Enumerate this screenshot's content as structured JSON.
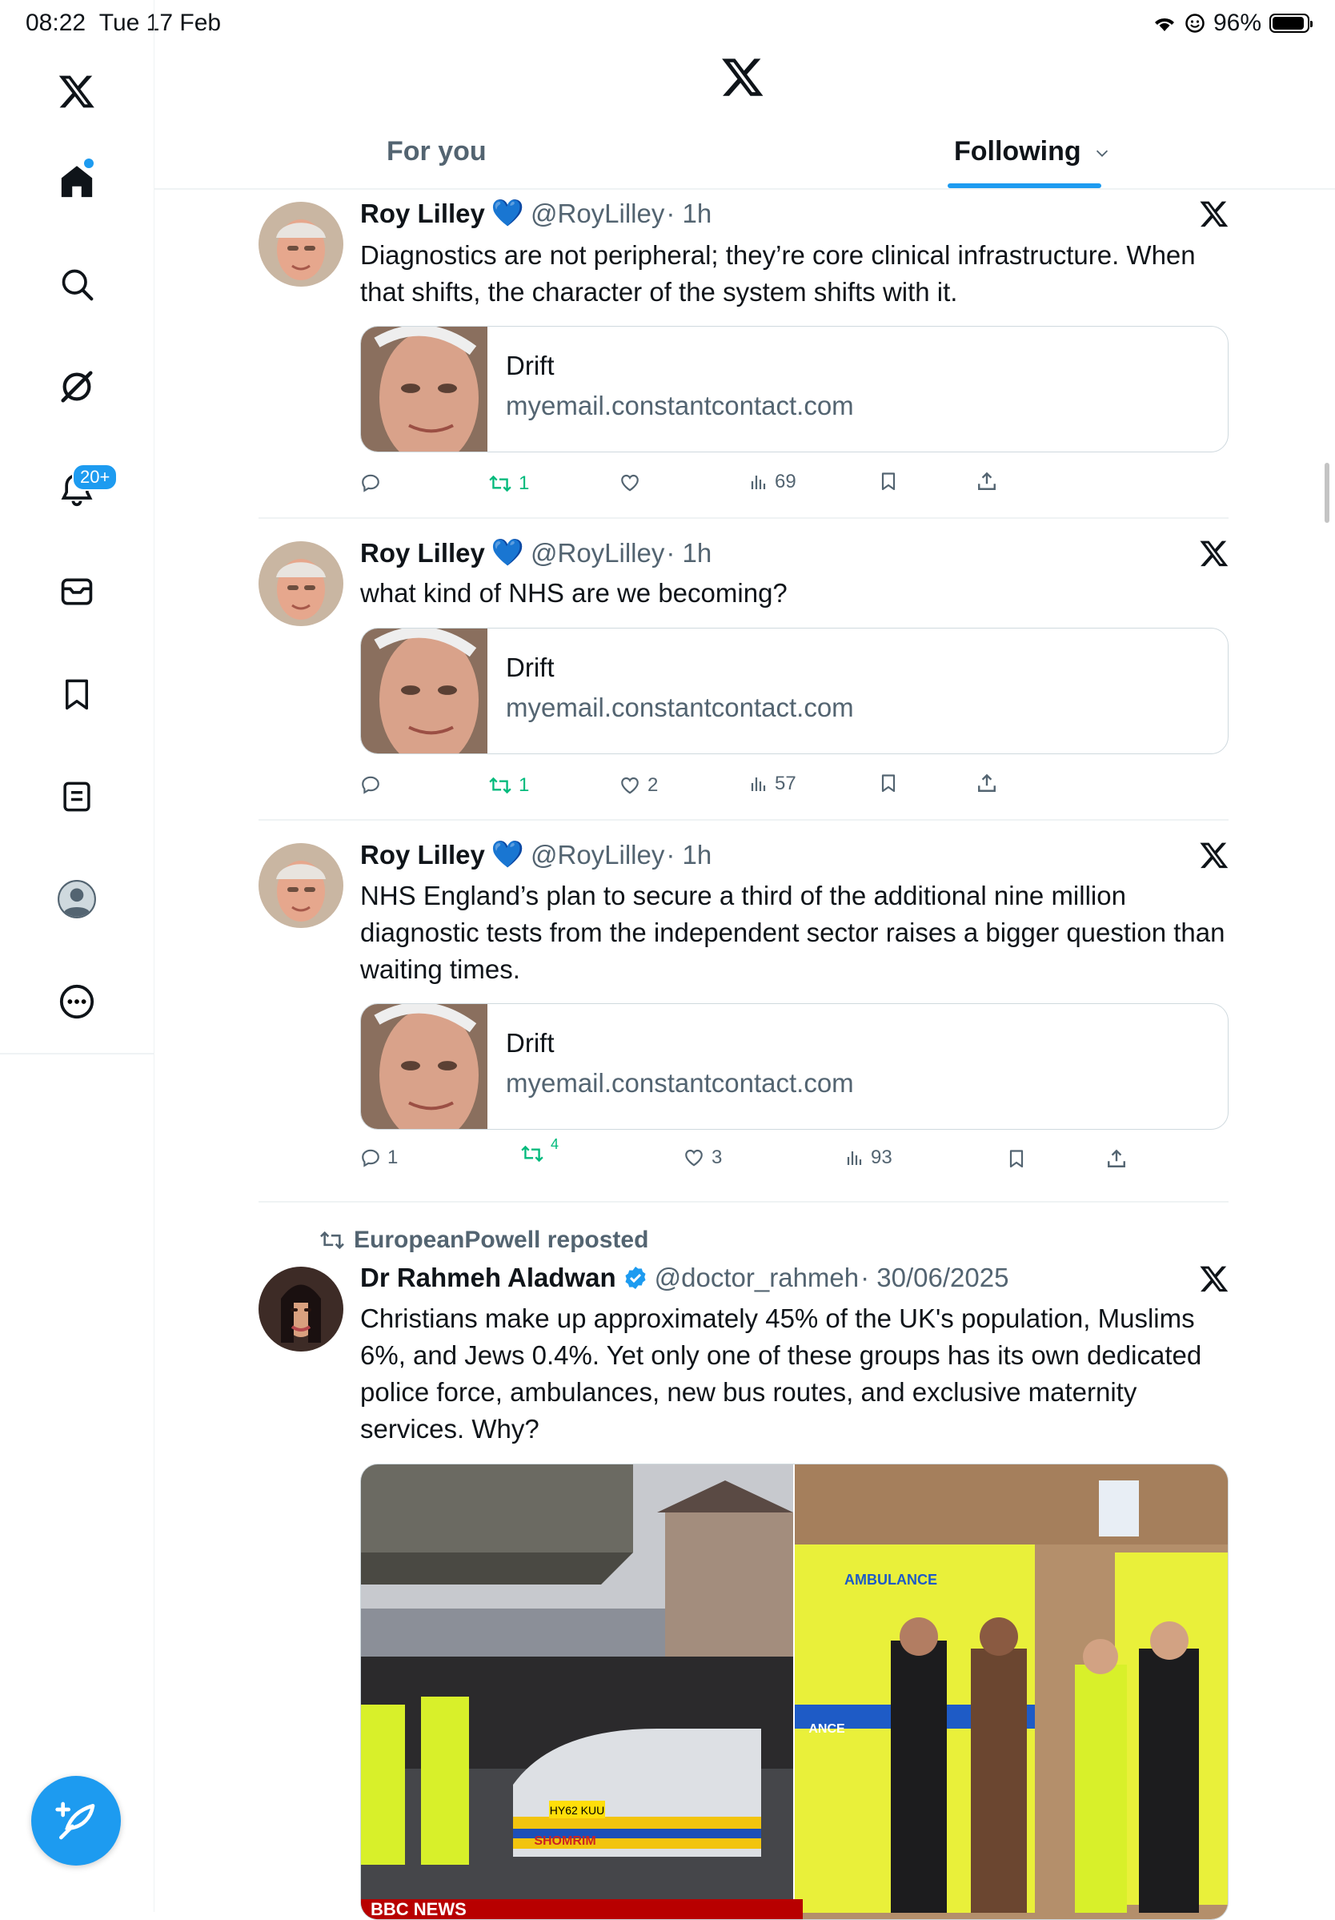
{
  "status_bar": {
    "time": "08:22",
    "date": "Tue 17 Feb",
    "battery": "96%"
  },
  "nav": {
    "notifications_badge": "20+"
  },
  "header": {
    "tab_for_you": "For you",
    "tab_following": "Following"
  },
  "tweets": [
    {
      "name": "Roy Lilley",
      "emoji": "💙",
      "handle": "@RoyLilley",
      "time": "· 1h",
      "text": "Diagnostics are not peripheral; they’re core clinical infrastructure. When that shifts, the character of the system shifts with it.",
      "card": {
        "title": "Drift",
        "domain": "myemail.constantcontact.com"
      },
      "replies": "",
      "reposts": "1",
      "likes": "",
      "views": "69"
    },
    {
      "name": "Roy Lilley",
      "emoji": "💙",
      "handle": "@RoyLilley",
      "time": "· 1h",
      "text": "what kind of NHS are we becoming?",
      "card": {
        "title": "Drift",
        "domain": "myemail.constantcontact.com"
      },
      "replies": "",
      "reposts": "1",
      "likes": "2",
      "views": "57"
    },
    {
      "name": "Roy Lilley",
      "emoji": "💙",
      "handle": "@RoyLilley",
      "time": "· 1h",
      "text": "NHS England’s plan to secure a third of the additional nine million diagnostic tests from the independent sector raises a bigger question than waiting times.",
      "card": {
        "title": "Drift",
        "domain": "myemail.constantcontact.com"
      },
      "replies": "1",
      "reposts": "4",
      "likes": "3",
      "views": "93"
    },
    {
      "repost_label": "EuropeanPowell reposted",
      "name": "Dr Rahmeh Aladwan",
      "handle": "@doctor_rahmeh",
      "time": "· 30/06/2025",
      "text": "Christians make up approximately 45% of the UK's population, Muslims 6%, and Jews 0.4%. Yet only one of these groups has its own dedicated police force, ambulances, new bus routes, and exclusive maternity services. Why?",
      "media_left_text": "SHOMRIM",
      "media_left_plate": "HY62 KUU",
      "media_right_text": "AMBULANCE",
      "media_right_sub": "ANCE",
      "media_caption": "BBC NEWS"
    }
  ],
  "colors": {
    "accent": "#1d9bf0",
    "repost_green": "#00ba7c",
    "muted": "#536471",
    "border": "#eff3f4"
  }
}
